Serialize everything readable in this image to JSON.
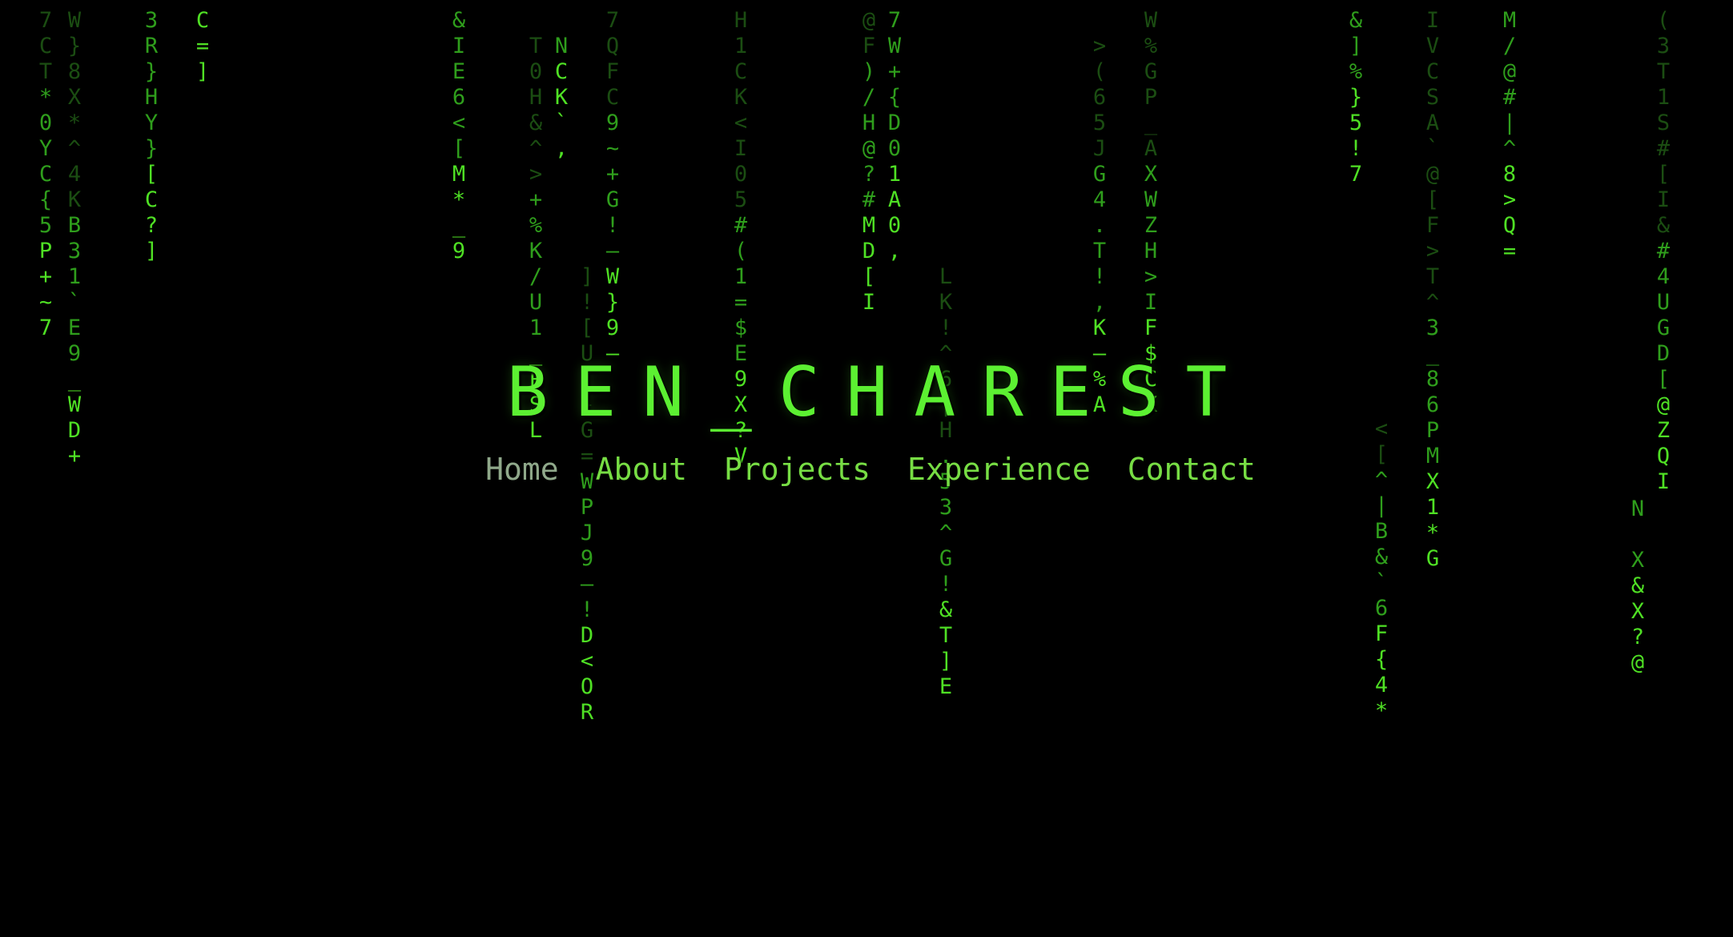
{
  "page": {
    "background": "#000000",
    "rain_colors": {
      "bright": "#4fe024",
      "mid": "#2f9e1c",
      "dim": "#1b4d12"
    }
  },
  "hero": {
    "title": "BEN_CHAREST",
    "title_color": "#5cf032"
  },
  "nav": {
    "items": [
      {
        "label": "Home",
        "active": true
      },
      {
        "label": "About"
      },
      {
        "label": "Projects"
      },
      {
        "label": "Experience"
      },
      {
        "label": "Contact"
      }
    ]
  },
  "rain": {
    "columns": [
      "7CT*0YC{5P+~7",
      "W}8X*^4KB31`E9_WD+",
      "3R}HY}[C?]",
      "C=]",
      "&IE6<[M*_9",
      "T0H&^>+%K/U1_PSL",
      "NCK`,",
      "7QFC9~+G!—W}9—",
      "]![U:}G=WPJ9—!D<OR",
      "H1CK<I05#(1=$E9X?V",
      "@F)/H@?#MD[I",
      "7W+{D01A0,",
      "LK!^6|H.53^G!&T]E",
      ">(65JG4.T!,K—%A",
      "W%GP_AXWZH>IF$CX",
      "&]%}5!7",
      "IVCSA`@[F>T^3_86PMX1*G",
      "<[^|B&`6F{4*",
      "M/@#|^8>Q=",
      "(3T1S#[I&#4UGD[@ZQI",
      "N X&X?@"
    ]
  }
}
